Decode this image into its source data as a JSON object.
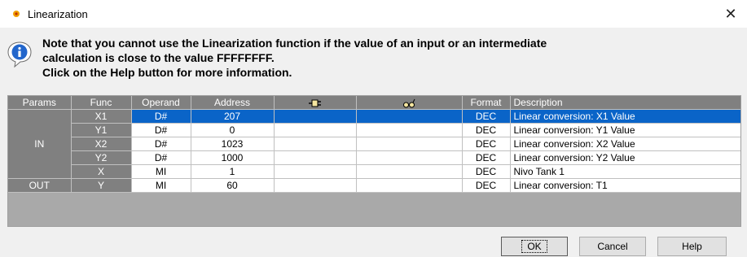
{
  "window": {
    "title": "Linearization",
    "close_glyph": "✕",
    "title_icon": "dot-icon",
    "close_icon": "close-icon"
  },
  "note": {
    "icon": "info-icon",
    "line1": "Note that you cannot use the Linearization function if the value of an input or an intermediate",
    "line2": "calculation is close to the value FFFFFFFF.",
    "line3": "Click on the Help button for more information."
  },
  "grid": {
    "headers": {
      "params": "Params",
      "func": "Func",
      "operand": "Operand",
      "address": "Address",
      "plug_icon": "plug-icon",
      "glasses_icon": "glasses-icon",
      "format": "Format",
      "description": "Description"
    },
    "groups": [
      {
        "label": "IN"
      },
      {
        "label": "OUT"
      }
    ],
    "rows": [
      {
        "func": "X1",
        "operand": "D#",
        "address": "207",
        "format": "DEC",
        "description": "Linear conversion: X1 Value",
        "selected": true
      },
      {
        "func": "Y1",
        "operand": "D#",
        "address": "0",
        "format": "DEC",
        "description": "Linear conversion: Y1 Value"
      },
      {
        "func": "X2",
        "operand": "D#",
        "address": "1023",
        "format": "DEC",
        "description": "Linear conversion: X2 Value"
      },
      {
        "func": "Y2",
        "operand": "D#",
        "address": "1000",
        "format": "DEC",
        "description": "Linear conversion: Y2 Value"
      },
      {
        "func": "X",
        "operand": "MI",
        "address": "1",
        "format": "DEC",
        "description": "Nivo Tank 1"
      },
      {
        "func": "Y",
        "operand": "MI",
        "address": "60",
        "format": "DEC",
        "description": "Linear conversion: T1"
      }
    ]
  },
  "buttons": {
    "ok": "OK",
    "cancel": "Cancel",
    "help": "Help"
  },
  "colors": {
    "selection": "#0a64c8",
    "header_grey": "#808080",
    "title_icon": "#f0a000"
  }
}
